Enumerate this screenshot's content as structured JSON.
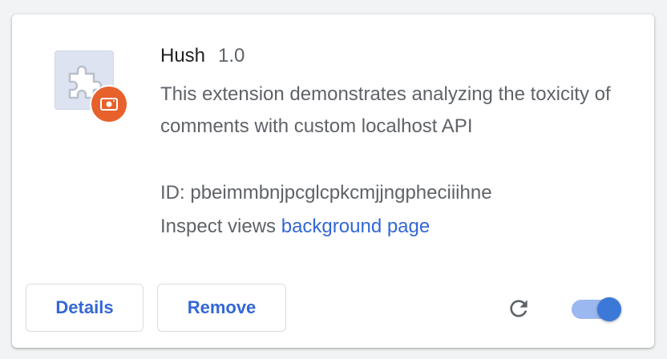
{
  "extension": {
    "name": "Hush",
    "version": "1.0",
    "description": "This extension demonstrates analyzing the toxicity of comments with custom localhost API",
    "id_label": "ID:",
    "id_value": "pbeimmbnjpcglcpkcmjjngpheciiihne",
    "inspect_label": "Inspect views",
    "inspect_link": "background page",
    "icon": "puzzle-piece-icon",
    "badge_icon": "camera-icon",
    "enabled": true
  },
  "actions": {
    "details_label": "Details",
    "remove_label": "Remove",
    "reload_icon": "reload-icon",
    "toggle_icon": "toggle-switch"
  },
  "colors": {
    "accent": "#3367d6",
    "badge": "#e8602c",
    "toggle_knob": "#3c78d8",
    "toggle_track": "#9bb8f0"
  }
}
